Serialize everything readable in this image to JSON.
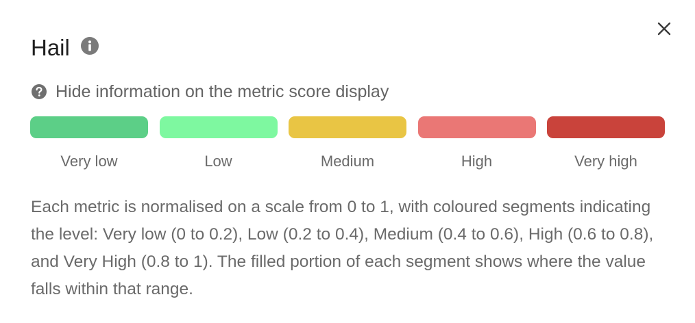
{
  "header": {
    "title": "Hail"
  },
  "icons": {
    "info": "info-icon",
    "help": "question-circle-icon",
    "close": "close-icon"
  },
  "toggle": {
    "label": "Hide information on the metric score display"
  },
  "scale": {
    "segments": [
      {
        "label": "Very low",
        "color": "#5ccf87"
      },
      {
        "label": "Low",
        "color": "#7ef8a0"
      },
      {
        "label": "Medium",
        "color": "#e9c544"
      },
      {
        "label": "High",
        "color": "#ea7775"
      },
      {
        "label": "Very high",
        "color": "#c9433b"
      }
    ]
  },
  "description": "Each metric is normalised on a scale from 0 to 1, with coloured segments indicating the level: Very low (0 to 0.2), Low (0.2 to 0.4), Medium (0.4 to 0.6), High (0.6 to 0.8), and Very High (0.8 to 1). The filled portion of each segment shows where the value falls within that range."
}
